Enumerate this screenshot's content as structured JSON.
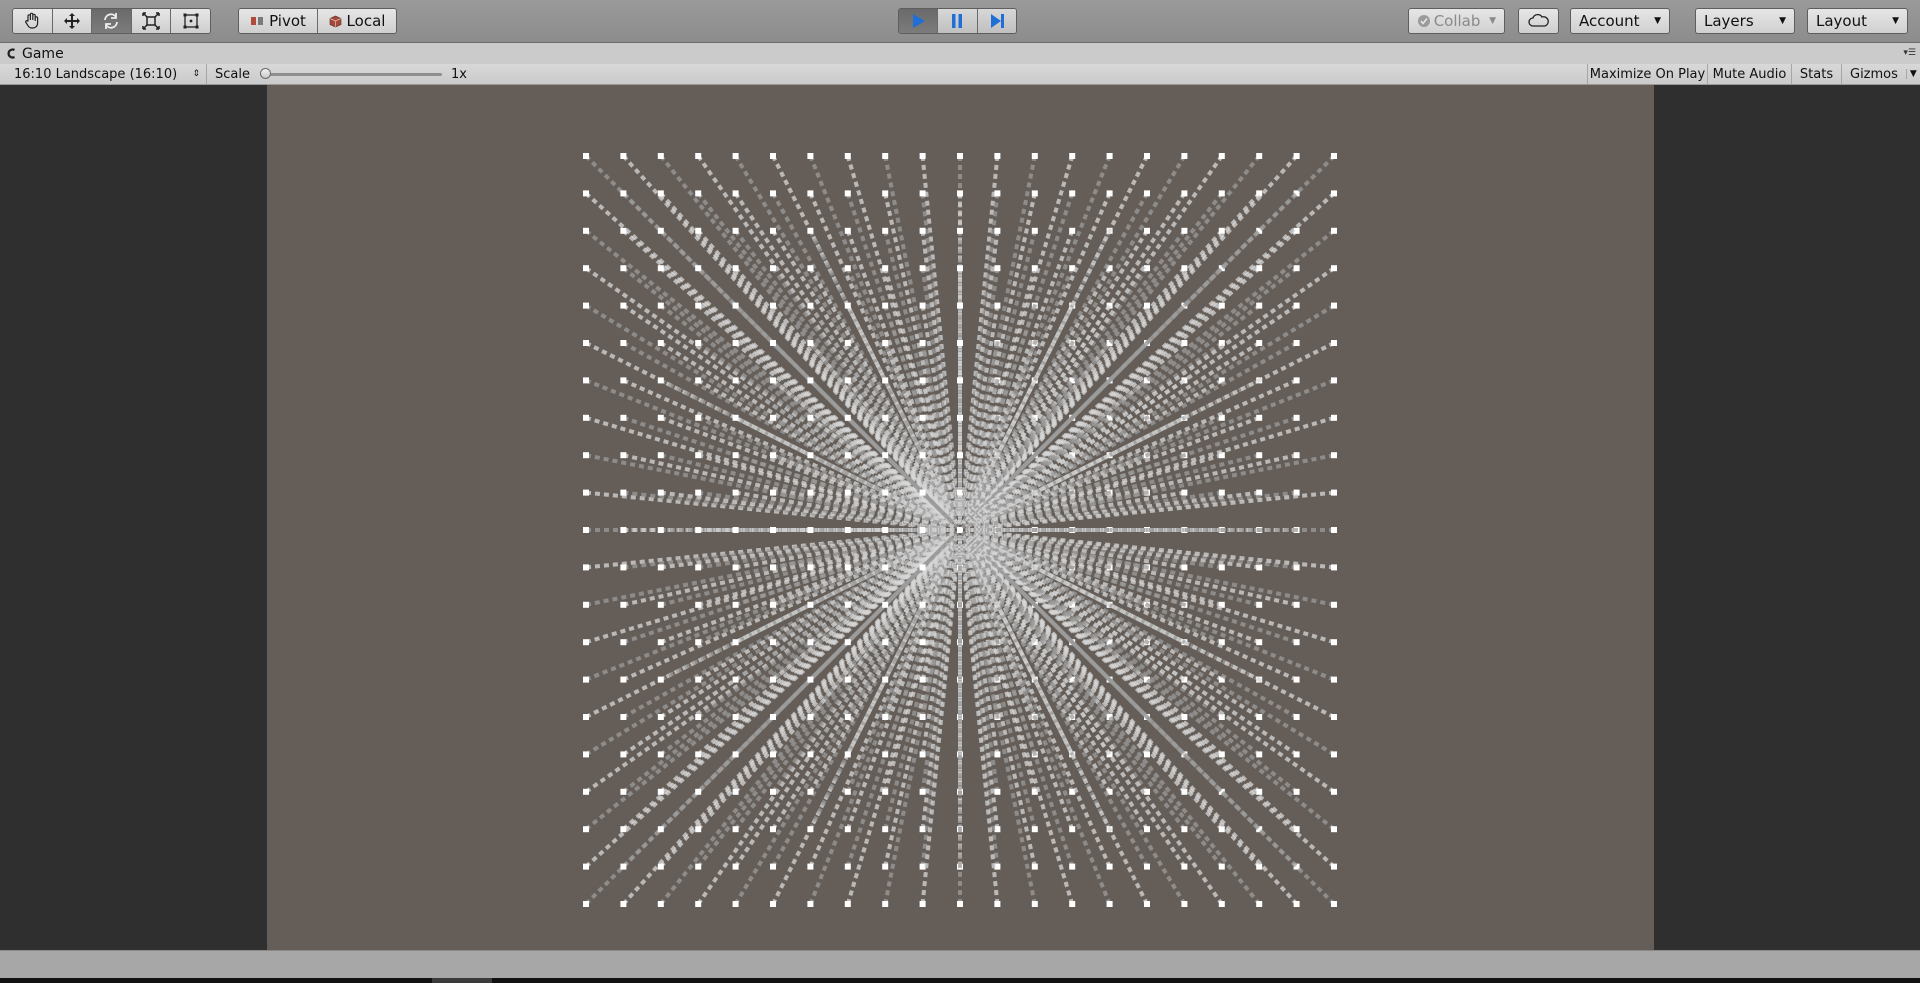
{
  "toolbar": {
    "tools": [
      "hand-tool",
      "move-tool",
      "rotate-tool",
      "scale-tool",
      "rect-tool"
    ],
    "pivot_label": "Pivot",
    "local_label": "Local",
    "collab_label": "Collab",
    "account_label": "Account",
    "layers_label": "Layers",
    "layout_label": "Layout",
    "accent_color": "#1f6fd6"
  },
  "game_tab": {
    "title": "Game"
  },
  "game_bar": {
    "aspect_label": "16:10 Landscape (16:10)",
    "scale_label": "Scale",
    "scale_value": "1x",
    "scale_level": 0,
    "maximize_label": "Maximize On Play",
    "mute_label": "Mute Audio",
    "stats_label": "Stats",
    "gizmos_label": "Gizmos"
  },
  "scene": {
    "background_color": "#655e58",
    "side_color": "#2f2f2f",
    "grid_divisions": 20
  }
}
